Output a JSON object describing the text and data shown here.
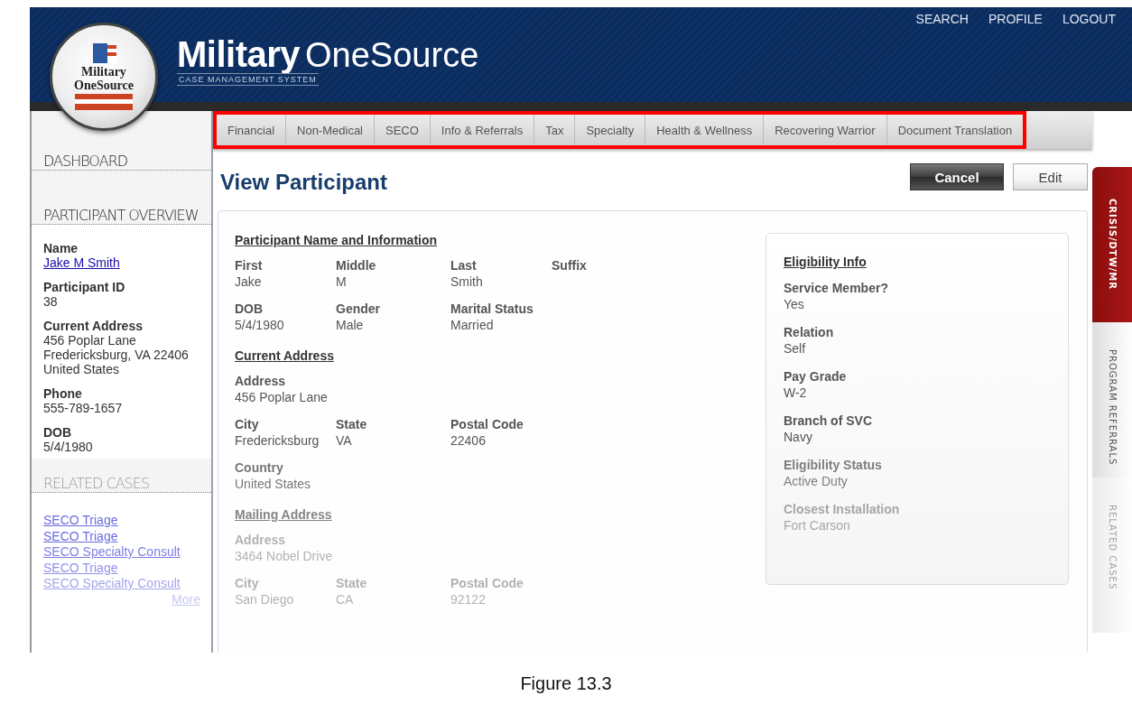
{
  "header": {
    "top_links": [
      "SEARCH",
      "PROFILE",
      "LOGOUT"
    ],
    "badge_lines": [
      "Military",
      "OneSource"
    ],
    "title_bold": "Military",
    "title_light": "OneSource",
    "subtitle": "CASE MANAGEMENT SYSTEM"
  },
  "nav": {
    "highlighted": true,
    "tabs": [
      {
        "label": "Financial",
        "selected": false
      },
      {
        "label": "Non-Medical",
        "selected": false
      },
      {
        "label": "SECO",
        "selected": false
      },
      {
        "label": "Info & Referrals",
        "selected": false
      },
      {
        "label": "Tax",
        "selected": false
      },
      {
        "label": "Specialty",
        "selected": false
      },
      {
        "label": "Health & Wellness",
        "selected": false
      },
      {
        "label": "Recovering Warrior",
        "selected": false
      },
      {
        "label": "Document Translation",
        "selected": false
      }
    ]
  },
  "sidebar": {
    "dashboard": "DASHBOARD",
    "overview_title": "PARTICIPANT OVERVIEW",
    "overview": [
      {
        "label": "Name",
        "lines": [
          "Jake M Smith"
        ],
        "kind": "link"
      },
      {
        "label": "Participant ID",
        "lines": [
          "38"
        ],
        "kind": "text"
      },
      {
        "label": "Current Address",
        "lines": [
          "456 Poplar Lane",
          "Fredericksburg,  VA  22406",
          "United States"
        ],
        "kind": "text"
      },
      {
        "label": "Phone",
        "lines": [
          "555-789-1657"
        ],
        "kind": "text"
      },
      {
        "label": "DOB",
        "lines": [
          "5/4/1980"
        ],
        "kind": "text"
      }
    ],
    "related_title": "RELATED CASES",
    "related_cases": [
      "SECO Triage",
      "SECO Triage",
      "SECO Specialty Consult",
      "SECO Triage",
      "SECO Specialty Consult"
    ],
    "more": "More"
  },
  "main": {
    "title": "View Participant",
    "buttons": [
      {
        "label": "Cancel",
        "kind": "dark"
      },
      {
        "label": "Edit",
        "kind": "light"
      }
    ],
    "details": [
      {
        "kind": "heading",
        "text": "Participant Name and Information"
      },
      {
        "kind": "fields",
        "fields": [
          {
            "label": "First",
            "value": "Jake"
          },
          {
            "label": "Middle",
            "value": "M"
          },
          {
            "label": "Last",
            "value": "Smith"
          },
          {
            "label": "Suffix"
          }
        ]
      },
      {
        "kind": "fields",
        "fields": [
          {
            "label": "DOB",
            "value": "5/4/1980"
          },
          {
            "label": "Gender",
            "value": "Male"
          },
          {
            "label": "Marital Status",
            "value": "Married"
          }
        ]
      },
      {
        "kind": "heading",
        "text": "Current Address"
      },
      {
        "kind": "fields",
        "fields": [
          {
            "label": "Address",
            "value": "456 Poplar Lane"
          }
        ]
      },
      {
        "kind": "fields",
        "fields": [
          {
            "label": "City",
            "value": "Fredericksburg"
          },
          {
            "label": "State",
            "value": "VA"
          },
          {
            "label": "Postal Code",
            "value": "22406"
          }
        ]
      },
      {
        "kind": "fields",
        "fields": [
          {
            "label": "Country",
            "value": "United States"
          }
        ]
      },
      {
        "kind": "heading",
        "text": "Mailing Address"
      },
      {
        "kind": "fields",
        "fields": [
          {
            "label": "Address",
            "value": "3464 Nobel Drive"
          }
        ]
      },
      {
        "kind": "fields",
        "fields": [
          {
            "label": "City",
            "value": "San Diego"
          },
          {
            "label": "State",
            "value": "CA"
          },
          {
            "label": "Postal Code",
            "value": "92122"
          }
        ]
      }
    ],
    "eligibility": {
      "title": "Eligibility Info",
      "fields": [
        {
          "label": "Service Member?",
          "value": "Yes"
        },
        {
          "label": "Relation",
          "value": "Self"
        },
        {
          "label": "Pay Grade",
          "value": "W-2"
        },
        {
          "label": "Branch of SVC",
          "value": "Navy"
        },
        {
          "label": "Eligibility Status",
          "value": "Active Duty"
        },
        {
          "label": "Closest Installation",
          "value": "Fort Carson"
        }
      ]
    }
  },
  "side_tabs": [
    {
      "label": "CRISIS/DTW/MR",
      "selected": true
    },
    {
      "label": "PROGRAM REFERRALS",
      "selected": false
    },
    {
      "label": "RELATED CASES",
      "selected": false
    }
  ],
  "caption": "Figure 13.3"
}
